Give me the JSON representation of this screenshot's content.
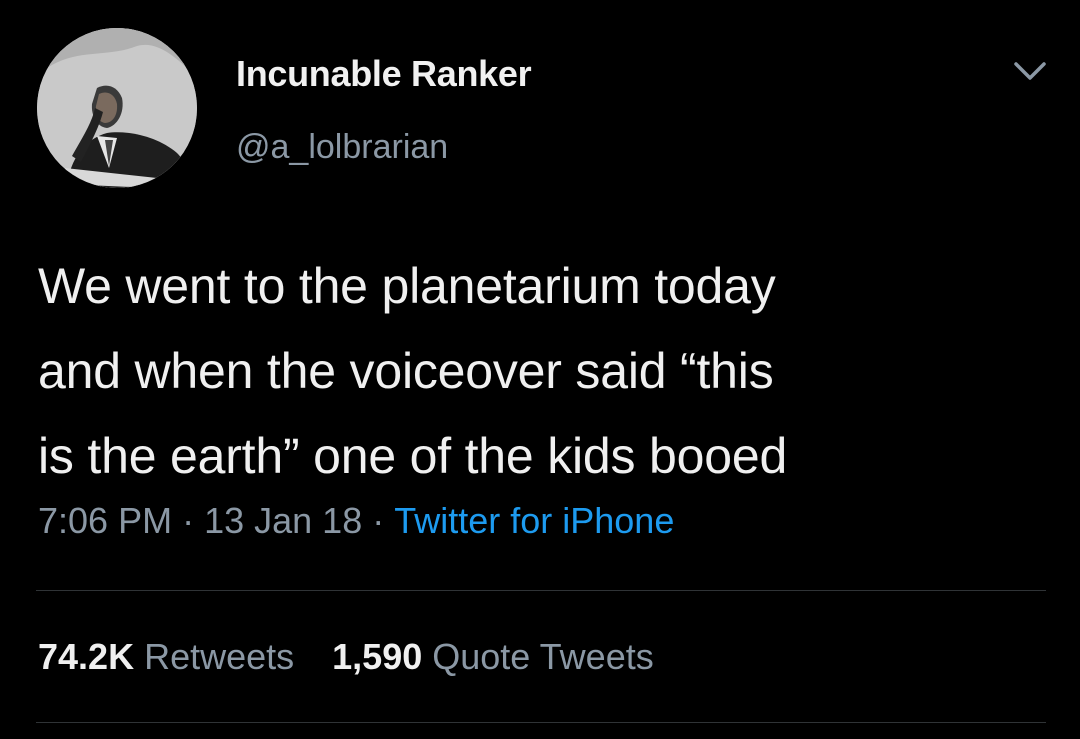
{
  "author": {
    "name": "Incunable Ranker",
    "handle": "@a_lolbrarian"
  },
  "tweet": {
    "lines": [
      "We went to the planetarium today",
      "and when the voiceover said “this",
      "is the earth” one of the kids booed"
    ]
  },
  "meta": {
    "time": "7:06 PM",
    "separator": "·",
    "date": "13 Jan 18",
    "source": "Twitter for iPhone"
  },
  "stats": {
    "retweets_count": "74.2K",
    "retweets_label": "Retweets",
    "quotes_count": "1,590",
    "quotes_label": "Quote Tweets"
  },
  "icons": {
    "menu": "chevron-down-icon",
    "avatar": "avatar-photo"
  },
  "colors": {
    "background": "#000000",
    "text": "#f0f0f0",
    "secondary": "#8b98a5",
    "link": "#1d9bf0",
    "divider": "#2f3336"
  }
}
